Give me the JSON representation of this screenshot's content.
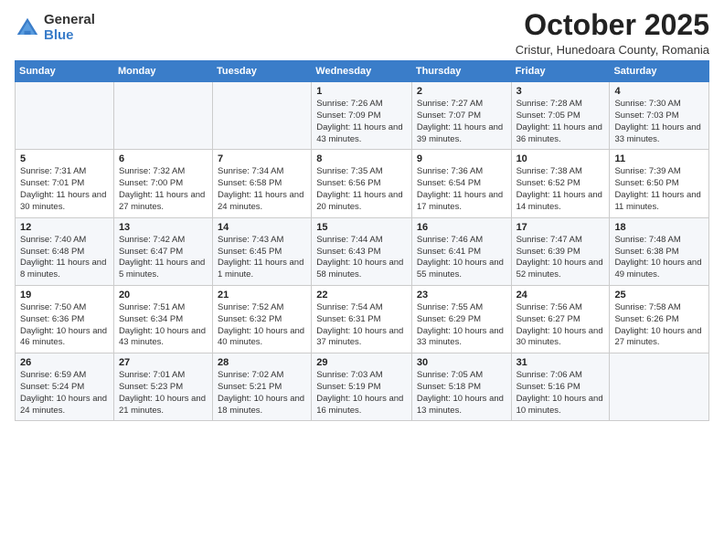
{
  "logo": {
    "general": "General",
    "blue": "Blue"
  },
  "title": {
    "month": "October 2025",
    "location": "Cristur, Hunedoara County, Romania"
  },
  "weekdays": [
    "Sunday",
    "Monday",
    "Tuesday",
    "Wednesday",
    "Thursday",
    "Friday",
    "Saturday"
  ],
  "weeks": [
    [
      {
        "day": "",
        "info": ""
      },
      {
        "day": "",
        "info": ""
      },
      {
        "day": "",
        "info": ""
      },
      {
        "day": "1",
        "info": "Sunrise: 7:26 AM\nSunset: 7:09 PM\nDaylight: 11 hours and 43 minutes."
      },
      {
        "day": "2",
        "info": "Sunrise: 7:27 AM\nSunset: 7:07 PM\nDaylight: 11 hours and 39 minutes."
      },
      {
        "day": "3",
        "info": "Sunrise: 7:28 AM\nSunset: 7:05 PM\nDaylight: 11 hours and 36 minutes."
      },
      {
        "day": "4",
        "info": "Sunrise: 7:30 AM\nSunset: 7:03 PM\nDaylight: 11 hours and 33 minutes."
      }
    ],
    [
      {
        "day": "5",
        "info": "Sunrise: 7:31 AM\nSunset: 7:01 PM\nDaylight: 11 hours and 30 minutes."
      },
      {
        "day": "6",
        "info": "Sunrise: 7:32 AM\nSunset: 7:00 PM\nDaylight: 11 hours and 27 minutes."
      },
      {
        "day": "7",
        "info": "Sunrise: 7:34 AM\nSunset: 6:58 PM\nDaylight: 11 hours and 24 minutes."
      },
      {
        "day": "8",
        "info": "Sunrise: 7:35 AM\nSunset: 6:56 PM\nDaylight: 11 hours and 20 minutes."
      },
      {
        "day": "9",
        "info": "Sunrise: 7:36 AM\nSunset: 6:54 PM\nDaylight: 11 hours and 17 minutes."
      },
      {
        "day": "10",
        "info": "Sunrise: 7:38 AM\nSunset: 6:52 PM\nDaylight: 11 hours and 14 minutes."
      },
      {
        "day": "11",
        "info": "Sunrise: 7:39 AM\nSunset: 6:50 PM\nDaylight: 11 hours and 11 minutes."
      }
    ],
    [
      {
        "day": "12",
        "info": "Sunrise: 7:40 AM\nSunset: 6:48 PM\nDaylight: 11 hours and 8 minutes."
      },
      {
        "day": "13",
        "info": "Sunrise: 7:42 AM\nSunset: 6:47 PM\nDaylight: 11 hours and 5 minutes."
      },
      {
        "day": "14",
        "info": "Sunrise: 7:43 AM\nSunset: 6:45 PM\nDaylight: 11 hours and 1 minute."
      },
      {
        "day": "15",
        "info": "Sunrise: 7:44 AM\nSunset: 6:43 PM\nDaylight: 10 hours and 58 minutes."
      },
      {
        "day": "16",
        "info": "Sunrise: 7:46 AM\nSunset: 6:41 PM\nDaylight: 10 hours and 55 minutes."
      },
      {
        "day": "17",
        "info": "Sunrise: 7:47 AM\nSunset: 6:39 PM\nDaylight: 10 hours and 52 minutes."
      },
      {
        "day": "18",
        "info": "Sunrise: 7:48 AM\nSunset: 6:38 PM\nDaylight: 10 hours and 49 minutes."
      }
    ],
    [
      {
        "day": "19",
        "info": "Sunrise: 7:50 AM\nSunset: 6:36 PM\nDaylight: 10 hours and 46 minutes."
      },
      {
        "day": "20",
        "info": "Sunrise: 7:51 AM\nSunset: 6:34 PM\nDaylight: 10 hours and 43 minutes."
      },
      {
        "day": "21",
        "info": "Sunrise: 7:52 AM\nSunset: 6:32 PM\nDaylight: 10 hours and 40 minutes."
      },
      {
        "day": "22",
        "info": "Sunrise: 7:54 AM\nSunset: 6:31 PM\nDaylight: 10 hours and 37 minutes."
      },
      {
        "day": "23",
        "info": "Sunrise: 7:55 AM\nSunset: 6:29 PM\nDaylight: 10 hours and 33 minutes."
      },
      {
        "day": "24",
        "info": "Sunrise: 7:56 AM\nSunset: 6:27 PM\nDaylight: 10 hours and 30 minutes."
      },
      {
        "day": "25",
        "info": "Sunrise: 7:58 AM\nSunset: 6:26 PM\nDaylight: 10 hours and 27 minutes."
      }
    ],
    [
      {
        "day": "26",
        "info": "Sunrise: 6:59 AM\nSunset: 5:24 PM\nDaylight: 10 hours and 24 minutes."
      },
      {
        "day": "27",
        "info": "Sunrise: 7:01 AM\nSunset: 5:23 PM\nDaylight: 10 hours and 21 minutes."
      },
      {
        "day": "28",
        "info": "Sunrise: 7:02 AM\nSunset: 5:21 PM\nDaylight: 10 hours and 18 minutes."
      },
      {
        "day": "29",
        "info": "Sunrise: 7:03 AM\nSunset: 5:19 PM\nDaylight: 10 hours and 16 minutes."
      },
      {
        "day": "30",
        "info": "Sunrise: 7:05 AM\nSunset: 5:18 PM\nDaylight: 10 hours and 13 minutes."
      },
      {
        "day": "31",
        "info": "Sunrise: 7:06 AM\nSunset: 5:16 PM\nDaylight: 10 hours and 10 minutes."
      },
      {
        "day": "",
        "info": ""
      }
    ]
  ]
}
